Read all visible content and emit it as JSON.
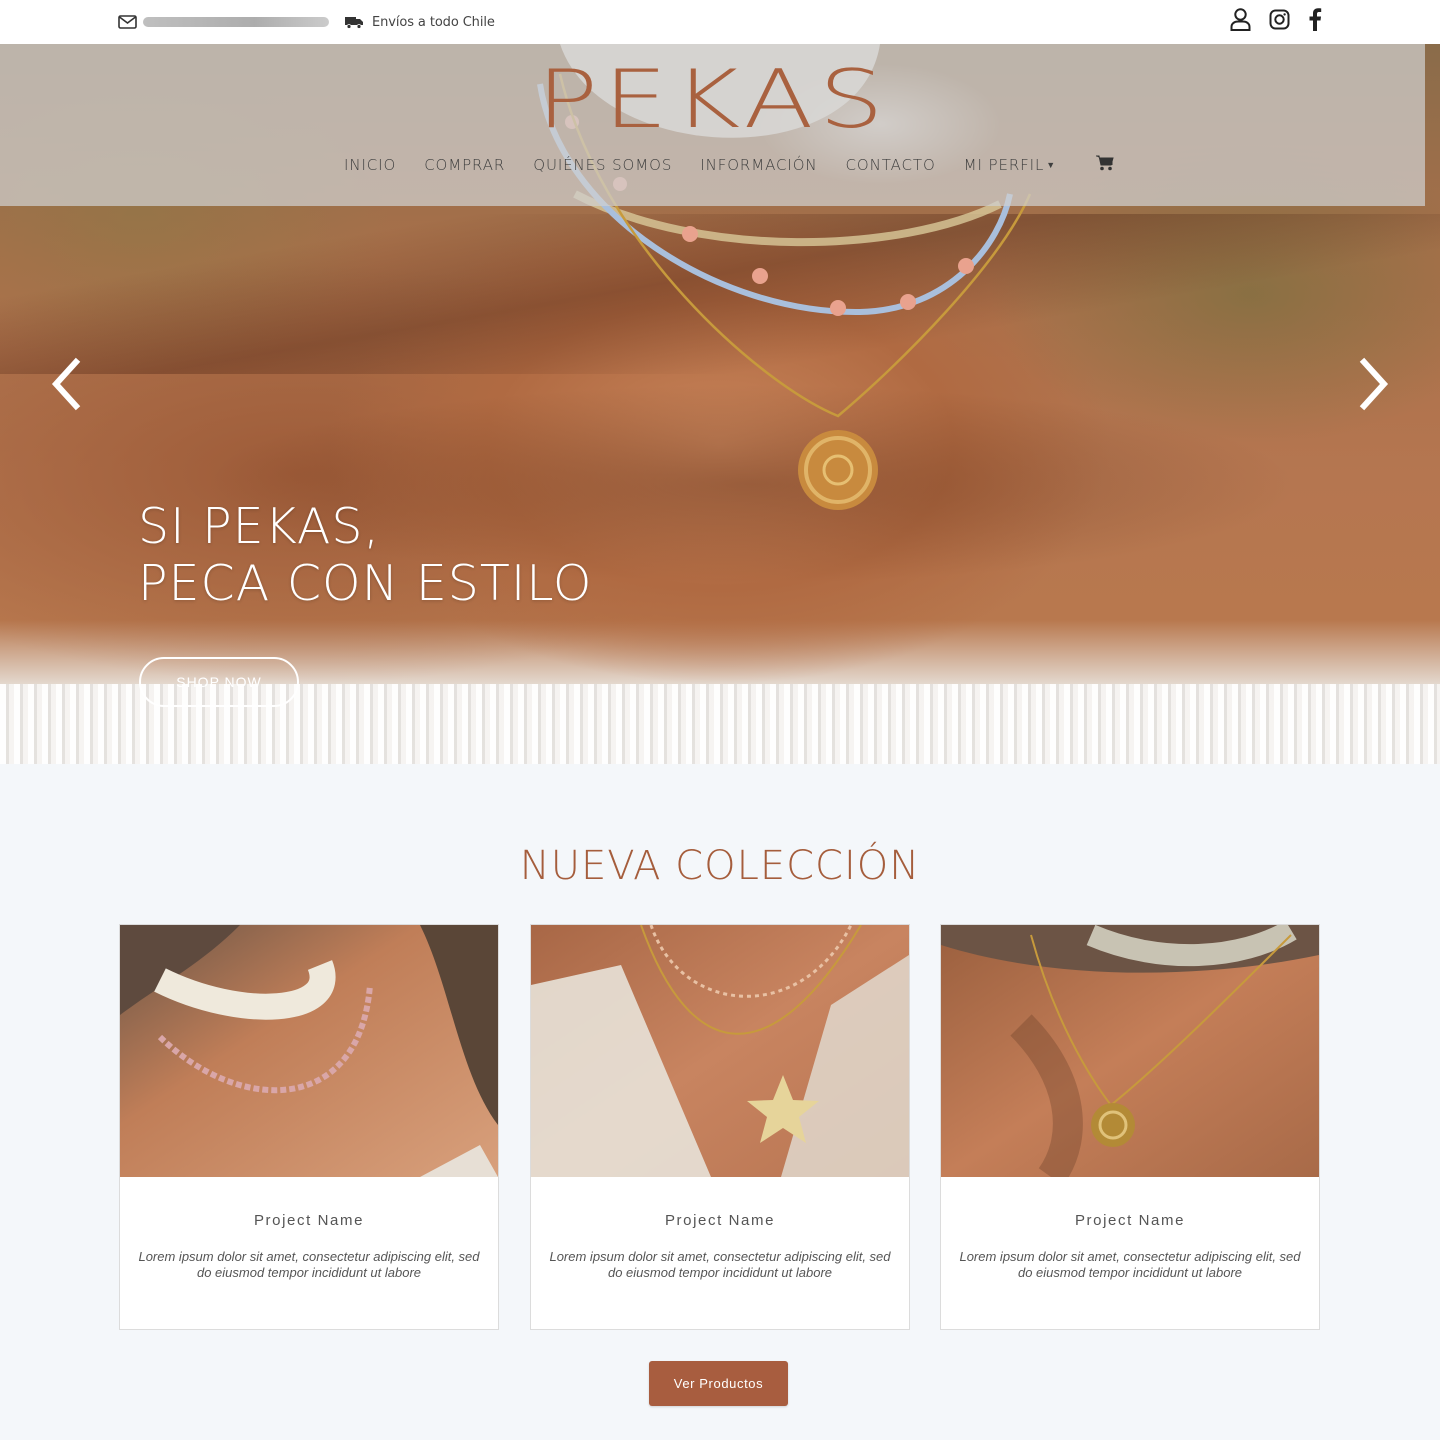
{
  "topbar": {
    "shipping_text": "Envíos a todo Chile",
    "icons": [
      "mail-icon",
      "truck-icon",
      "user-icon",
      "instagram-icon",
      "facebook-icon"
    ]
  },
  "header": {
    "logo": "PEKAS",
    "nav": {
      "inicio": "INICIO",
      "comprar": "COMPRAR",
      "quienes": "QUIÉNES SOMOS",
      "informacion": "INFORMACIÓN",
      "contacto": "CONTACTO",
      "perfil": "MI PERFIL"
    }
  },
  "hero": {
    "title_line1": "SI PEKAS,",
    "title_line2": "PECA CON ESTILO",
    "cta": "SHOP NOW"
  },
  "collection": {
    "title": "NUEVA COLECCIÓN",
    "cards": [
      {
        "name": "Project Name",
        "desc": "Lorem ipsum dolor sit amet, consectetur adipiscing elit, sed do eiusmod tempor incididunt ut labore"
      },
      {
        "name": "Project Name",
        "desc": "Lorem ipsum dolor sit amet, consectetur adipiscing elit, sed do eiusmod tempor incididunt ut labore"
      },
      {
        "name": "Project Name",
        "desc": "Lorem ipsum dolor sit amet, consectetur adipiscing elit, sed do eiusmod tempor incididunt ut labore"
      }
    ],
    "button": "Ver Productos"
  },
  "colors": {
    "brand": "#a85d3f",
    "section_bg": "#f4f7fa"
  }
}
